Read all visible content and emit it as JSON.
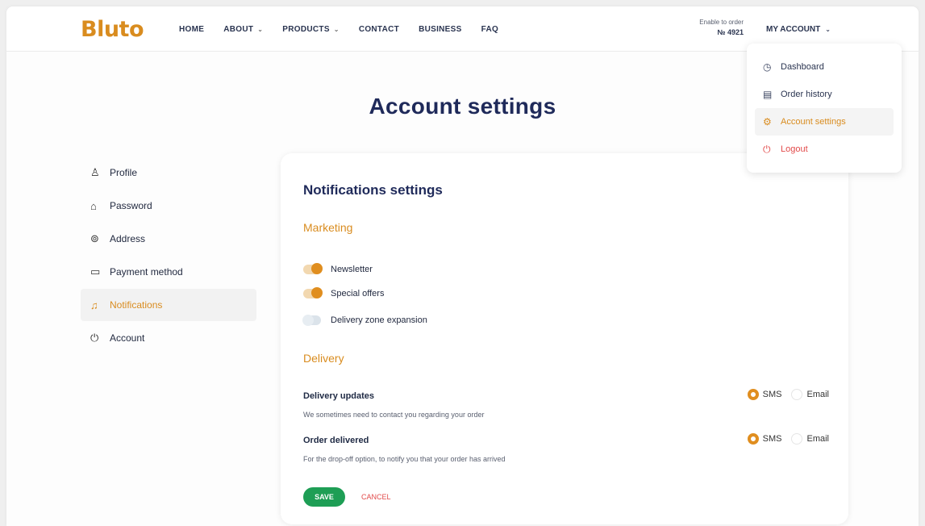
{
  "brand": {
    "logo_text": "Bluto",
    "accent": "#d98c1f",
    "success": "#1e9e55",
    "danger": "#e24a4a"
  },
  "nav": {
    "items": [
      {
        "label": "HOME",
        "has_chevron": false
      },
      {
        "label": "ABOUT",
        "has_chevron": true
      },
      {
        "label": "PRODUCTS",
        "has_chevron": true
      },
      {
        "label": "CONTACT",
        "has_chevron": false
      },
      {
        "label": "BUSINESS",
        "has_chevron": false
      },
      {
        "label": "FAQ",
        "has_chevron": false
      }
    ],
    "order_label": "Enable to order",
    "order_value": "№ 4921",
    "account_label": "MY ACCOUNT"
  },
  "account_menu": {
    "items": [
      {
        "label": "Dashboard",
        "icon": "clock-icon"
      },
      {
        "label": "Order history",
        "icon": "document-icon"
      },
      {
        "label": "Account settings",
        "icon": "gear-icon",
        "active": true
      },
      {
        "label": "Logout",
        "icon": "power-icon",
        "danger": true
      }
    ]
  },
  "page": {
    "title": "Account settings"
  },
  "sidebar": {
    "items": [
      {
        "label": "Profile",
        "icon": "user-icon"
      },
      {
        "label": "Password",
        "icon": "lock-icon"
      },
      {
        "label": "Address",
        "icon": "location-icon"
      },
      {
        "label": "Payment method",
        "icon": "card-icon"
      },
      {
        "label": "Notifications",
        "icon": "bell-icon",
        "active": true
      },
      {
        "label": "Account",
        "icon": "power-icon"
      }
    ]
  },
  "notifications": {
    "title": "Notifications settings",
    "marketing": {
      "title": "Marketing",
      "toggles": [
        {
          "label": "Newsletter",
          "on": true
        },
        {
          "label": "Special offers",
          "on": true
        },
        {
          "label": "Delivery zone expansion",
          "on": false
        }
      ]
    },
    "delivery": {
      "title": "Delivery",
      "rows": [
        {
          "name": "Delivery updates",
          "desc": "We sometimes need to contact you regarding your order",
          "options": [
            "SMS",
            "Email"
          ],
          "selected": "SMS"
        },
        {
          "name": "Order delivered",
          "desc": "For the drop-off option, to notify you that your order has arrived",
          "options": [
            "SMS",
            "Email"
          ],
          "selected": "SMS"
        }
      ]
    },
    "save_label": "SAVE",
    "cancel_label": "CANCEL"
  }
}
